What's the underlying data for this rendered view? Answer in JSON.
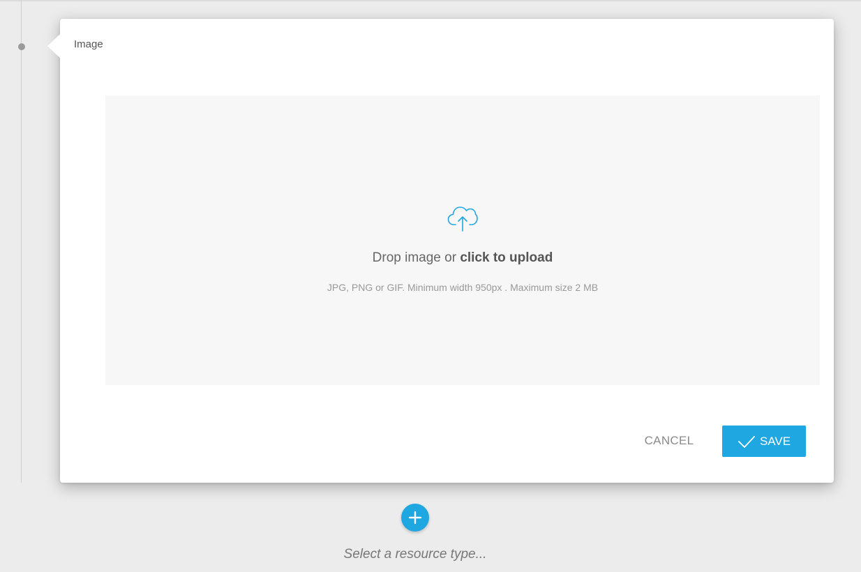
{
  "card": {
    "title": "Image"
  },
  "dropzone": {
    "prompt_prefix": "Drop image or ",
    "prompt_link": "click to upload",
    "hint": "JPG, PNG or GIF. Minimum width 950px . Maximum size 2 MB",
    "icon": "cloud-upload-icon"
  },
  "actions": {
    "cancel_label": "CANCEL",
    "save_label": "SAVE",
    "save_icon": "check-icon"
  },
  "footer": {
    "add_icon": "plus-icon",
    "select_prompt": "Select a resource type..."
  },
  "colors": {
    "accent": "#1ea7e1",
    "background": "#ececec",
    "card": "#ffffff",
    "dropzone": "#f7f7f7"
  }
}
